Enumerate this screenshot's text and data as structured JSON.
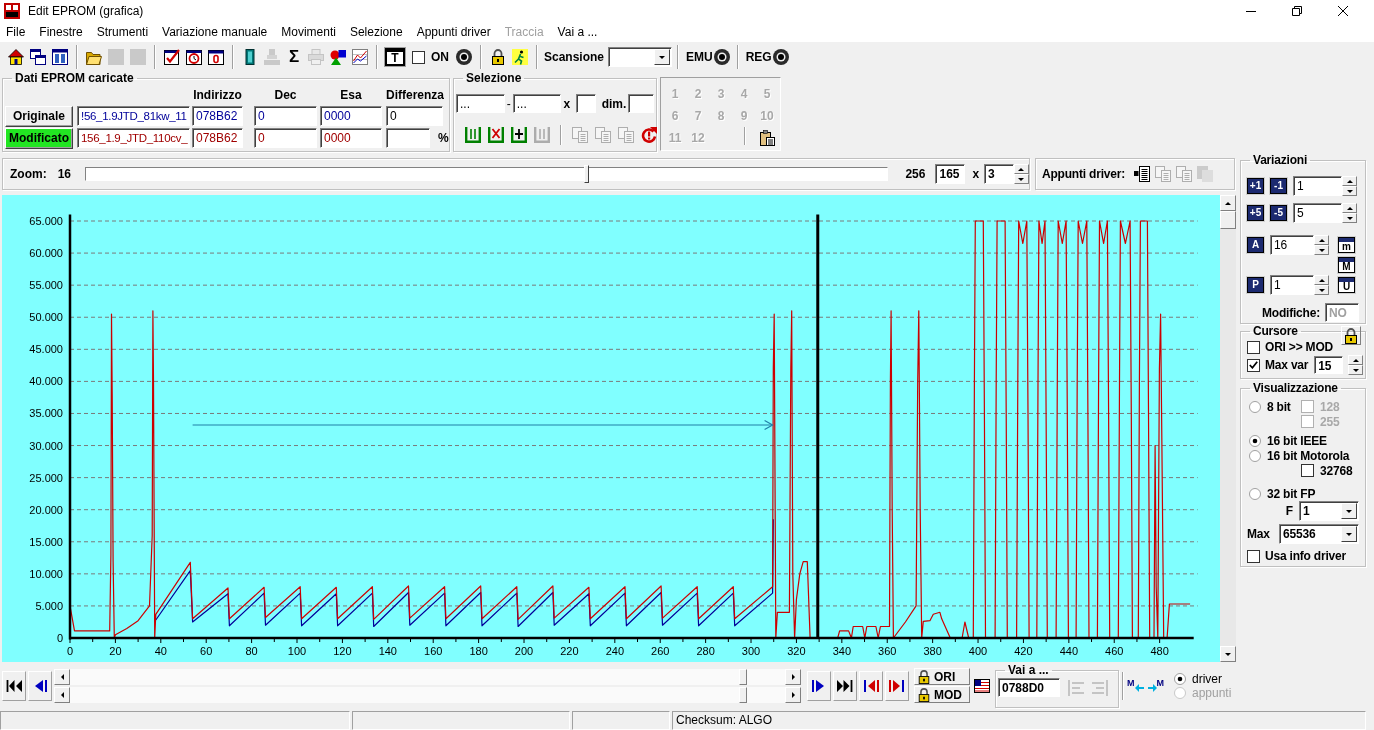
{
  "window": {
    "title": "Edit EPROM (grafica)"
  },
  "menu": [
    {
      "label": "File",
      "disabled": false
    },
    {
      "label": "Finestre",
      "disabled": false
    },
    {
      "label": "Strumenti",
      "disabled": false
    },
    {
      "label": "Variazione manuale",
      "disabled": false
    },
    {
      "label": "Movimenti",
      "disabled": false
    },
    {
      "label": "Selezione",
      "disabled": false
    },
    {
      "label": "Appunti driver",
      "disabled": false
    },
    {
      "label": "Traccia",
      "disabled": true
    },
    {
      "label": "Vai a ...",
      "disabled": false
    }
  ],
  "toolbar": [
    {
      "kind": "button",
      "disabled": false
    },
    {
      "kind": "button",
      "disabled": false
    },
    {
      "kind": "button",
      "disabled": false
    },
    {
      "kind": "separator"
    },
    {
      "kind": "button",
      "disabled": false
    },
    {
      "kind": "button",
      "disabled": true
    },
    {
      "kind": "button",
      "disabled": true
    },
    {
      "kind": "separator"
    },
    {
      "kind": "button",
      "disabled": false
    },
    {
      "kind": "button",
      "disabled": false
    },
    {
      "kind": "button",
      "disabled": false
    },
    {
      "kind": "separator"
    },
    {
      "kind": "button",
      "disabled": false
    },
    {
      "kind": "button",
      "disabled": true
    },
    {
      "kind": "glyph",
      "label": "Σ",
      "disabled": false
    },
    {
      "kind": "button",
      "disabled": true
    },
    {
      "kind": "button",
      "disabled": false
    },
    {
      "kind": "button",
      "disabled": false
    },
    {
      "kind": "separator"
    },
    {
      "kind": "tile",
      "label": "T",
      "disabled": false
    },
    {
      "kind": "checkbox",
      "label": "ON",
      "checked": false
    },
    {
      "kind": "button",
      "disabled": false
    },
    {
      "kind": "separator"
    },
    {
      "kind": "button",
      "disabled": false
    },
    {
      "kind": "button",
      "disabled": false
    },
    {
      "kind": "separator"
    },
    {
      "kind": "combo",
      "label": "Scansione"
    },
    {
      "kind": "separator"
    },
    {
      "kind": "labeled",
      "label": "EMU"
    },
    {
      "kind": "separator"
    },
    {
      "kind": "labeled",
      "label": "REG"
    }
  ],
  "eprom_data": {
    "title": "Dati EPROM caricate",
    "columns": [
      "Indirizzo",
      "Dec",
      "Esa",
      "Differenza"
    ],
    "rows": [
      {
        "label": "Originale",
        "selected": false,
        "color": "#000099",
        "file": "!56_1.9JTD_81kw_11",
        "address": "078B62",
        "dec": "0",
        "hex": "0000",
        "difference": "0"
      },
      {
        "label": "Modificato",
        "selected": true,
        "color": "#a00000",
        "file": "156_1.9_JTD_110cv_",
        "address": "078B62",
        "dec": "0",
        "hex": "0000",
        "unit": "%"
      }
    ]
  },
  "selection": {
    "title": "Selezione",
    "from": "...",
    "separator": "-",
    "to": "...",
    "times": "x",
    "dim_label": "dim.",
    "tools": [
      {
        "disabled": false
      },
      {
        "disabled": false
      },
      {
        "disabled": false
      },
      {
        "disabled": true
      },
      {
        "disabled": true
      },
      {
        "disabled": true
      },
      {
        "disabled": true
      },
      {
        "disabled": false
      }
    ]
  },
  "number_pad": {
    "keys": [
      {
        "label": "1",
        "disabled": true
      },
      {
        "label": "2",
        "disabled": true
      },
      {
        "label": "3",
        "disabled": true
      },
      {
        "label": "4",
        "disabled": true
      },
      {
        "label": "5",
        "disabled": true
      },
      {
        "label": "6",
        "disabled": true
      },
      {
        "label": "7",
        "disabled": true
      },
      {
        "label": "8",
        "disabled": true
      },
      {
        "label": "9",
        "disabled": true
      },
      {
        "label": "10",
        "disabled": true
      },
      {
        "label": "11",
        "disabled": true
      },
      {
        "label": "12",
        "disabled": true
      }
    ],
    "clipboard": {
      "disabled": false
    }
  },
  "zoom": {
    "label": "Zoom:",
    "min": "16",
    "level": 0.624,
    "max": "256",
    "value": "165",
    "times": "x",
    "factor": "3"
  },
  "driver_notes": {
    "label": "Appunti driver:",
    "tools": [
      {
        "disabled": false
      },
      {
        "disabled": true
      },
      {
        "disabled": true
      },
      {
        "disabled": true
      }
    ]
  },
  "chart": {
    "end_arrow": true,
    "chart_data": {
      "type": "line",
      "grid": true,
      "xlim": [
        0,
        495
      ],
      "ylim": [
        0,
        66
      ],
      "xticks": [
        0,
        20,
        40,
        60,
        80,
        100,
        120,
        140,
        160,
        180,
        200,
        220,
        240,
        260,
        280,
        300,
        320,
        340,
        360,
        380,
        400,
        420,
        440,
        460,
        480
      ],
      "yticks": [
        {
          "value": 0,
          "label": "0"
        },
        {
          "value": 5,
          "label": "5.000"
        },
        {
          "value": 10,
          "label": "10.000"
        },
        {
          "value": 15,
          "label": "15.000"
        },
        {
          "value": 20,
          "label": "20.000"
        },
        {
          "value": 25,
          "label": "25.000"
        },
        {
          "value": 30,
          "label": "30.000"
        },
        {
          "value": 35,
          "label": "35.000"
        },
        {
          "value": 40,
          "label": "40.000"
        },
        {
          "value": 45,
          "label": "45.000"
        },
        {
          "value": 50,
          "label": "50.000"
        },
        {
          "value": 55,
          "label": "55.000"
        },
        {
          "value": 60,
          "label": "60.000"
        },
        {
          "value": 65,
          "label": "65.000"
        }
      ],
      "x": [
        0,
        2,
        17.5,
        18,
        18.3,
        18.6,
        19,
        19.5,
        20,
        25,
        30,
        35,
        36.2,
        36.5,
        36.8,
        37.3,
        37.8,
        53,
        54,
        69.6,
        70.2,
        85.5,
        86.1,
        101.4,
        102,
        117.3,
        117.9,
        133.2,
        133.8,
        149.1,
        149.7,
        165,
        165.6,
        180.9,
        181.5,
        196.8,
        197.4,
        212.7,
        213.3,
        228.6,
        229.2,
        244.5,
        245.1,
        260.4,
        261,
        276.3,
        276.9,
        292.2,
        292.8,
        309.5,
        309.8,
        310.2,
        310.9,
        311.6,
        316.9,
        317.5,
        317.9,
        318.4,
        319.2,
        320,
        321.5,
        323,
        324.8,
        326,
        338.2,
        339,
        343,
        344.2,
        345,
        349.2,
        350.1,
        351,
        355,
        356,
        357,
        361,
        361.4,
        361.7,
        362.2,
        362.7,
        368,
        372.7,
        373.4,
        373.9,
        374.5,
        375.2,
        375.9,
        378.8,
        380.3,
        383.2,
        384,
        387.8,
        393,
        394.2,
        395.9,
        397.9,
        398.4,
        398.8,
        402.3,
        402.8,
        403.3,
        407.5,
        408,
        408.4,
        411.9,
        412.4,
        412.9,
        417,
        417.5,
        417.9,
        419.7,
        421.5,
        422,
        422.5,
        425.9,
        426.4,
        426.8,
        428.2,
        429.5,
        430,
        430.5,
        434.4,
        434.9,
        435.3,
        437.1,
        438.8,
        439.3,
        439.8,
        443.2,
        443.7,
        444.1,
        446,
        447.9,
        448.4,
        448.9,
        452.6,
        453.1,
        453.5,
        455.3,
        457,
        457.5,
        458,
        461.8,
        462.3,
        462.7,
        464.9,
        467,
        467.5,
        468,
        470.6,
        471.1,
        471.5,
        474.6,
        475.1,
        475.6,
        477.5,
        478,
        478.5,
        479.2,
        479.9,
        480.4,
        481,
        481.8,
        483.3,
        484.3,
        493.4
      ],
      "series": [
        {
          "color": "#000099",
          "values": [
            null,
            null,
            null,
            null,
            null,
            null,
            null,
            null,
            null,
            null,
            null,
            null,
            null,
            null,
            null,
            null,
            2.8,
            10.5,
            2.5,
            6.9,
            1.9,
            7,
            2,
            7,
            1.9,
            6.9,
            1.9,
            7,
            1.8,
            7.1,
            2,
            7,
            1.9,
            7.1,
            1.9,
            7,
            1.8,
            7.1,
            2,
            6.9,
            1.9,
            7,
            1.9,
            7.1,
            2,
            7,
            1.9,
            7,
            1.9,
            7,
            18.5,
            null,
            null,
            null,
            null,
            null,
            null,
            null,
            null,
            null,
            null,
            null,
            null,
            null,
            null,
            null,
            null,
            null,
            null,
            null,
            null,
            null,
            null,
            null,
            null,
            null,
            null,
            null,
            null,
            null,
            null,
            null,
            null,
            null,
            null,
            null,
            null,
            null,
            null,
            null,
            null,
            null,
            null,
            null,
            null,
            null,
            null,
            null,
            null,
            null,
            null,
            null,
            null,
            null,
            null,
            null,
            null,
            null,
            null,
            null,
            null,
            null,
            null,
            null,
            null,
            null,
            null,
            null,
            null,
            null,
            null,
            null,
            null,
            null,
            null,
            null,
            null,
            null,
            null,
            null,
            null,
            null,
            null,
            null,
            null,
            null,
            null,
            null,
            null,
            null,
            null,
            null,
            null,
            null,
            null,
            null,
            null,
            null,
            null,
            null,
            null,
            null,
            null,
            null,
            null,
            null,
            null,
            null,
            null,
            null,
            null,
            null,
            null,
            null,
            null,
            null
          ]
        },
        {
          "color": "#cc0000",
          "values": [
            5,
            1.1,
            1.1,
            13,
            50.5,
            38,
            12,
            0,
            0.5,
            1.5,
            2.7,
            5,
            16,
            51,
            40,
            0,
            3.7,
            11.8,
            3,
            7.8,
            3,
            7.9,
            3.2,
            8,
            3,
            7.9,
            3,
            8,
            2.9,
            8.1,
            3.1,
            8,
            3,
            8.1,
            3,
            8,
            2.9,
            8.1,
            3.1,
            7.9,
            3,
            8,
            3,
            8.1,
            3.1,
            8,
            3,
            8,
            3,
            8,
            42,
            50.5,
            0,
            4,
            4,
            42,
            51,
            10,
            0,
            6,
            10,
            11.9,
            11.9,
            0,
            0,
            1.1,
            1.1,
            0,
            1.8,
            1.8,
            0,
            1.8,
            1.8,
            0,
            1.8,
            1.8,
            40,
            51,
            20,
            0,
            2.5,
            5,
            40,
            51,
            20,
            0,
            2.6,
            2.7,
            3.7,
            4,
            3,
            0,
            0,
            2.5,
            0,
            0,
            40,
            65,
            65,
            35,
            0,
            0,
            40,
            65,
            65,
            35,
            0,
            0,
            40,
            65,
            61.5,
            65,
            35,
            0,
            0,
            40,
            65,
            61.5,
            65,
            35,
            0,
            0,
            40,
            65,
            61.5,
            65,
            35,
            0,
            0,
            40,
            65,
            61.5,
            65,
            35,
            0,
            0,
            40,
            65,
            61.5,
            65,
            35,
            0,
            0,
            40,
            65,
            61.5,
            65,
            35,
            0,
            0,
            40,
            65,
            65,
            35,
            0,
            0,
            30,
            8,
            0,
            42,
            50.5,
            30,
            0,
            0,
            5.3,
            5.3
          ]
        },
        {
          "color": "#2080a8",
          "values": [
            null,
            null,
            null,
            null,
            null,
            null,
            null,
            null,
            null,
            null,
            null,
            null,
            null,
            null,
            null,
            null,
            null,
            null,
            33.2,
            33.2,
            33.2,
            33.2,
            33.2,
            33.2,
            33.2,
            33.2,
            33.2,
            33.2,
            33.2,
            33.2,
            33.2,
            33.2,
            33.2,
            33.2,
            33.2,
            33.2,
            33.2,
            33.2,
            33.2,
            33.2,
            33.2,
            33.2,
            33.2,
            33.2,
            33.2,
            33.2,
            33.2,
            33.2,
            33.2,
            33.2,
            null,
            null,
            null,
            null,
            null,
            null,
            null,
            null,
            null,
            null,
            null,
            null,
            null,
            null,
            null,
            null,
            null,
            null,
            null,
            null,
            null,
            null,
            null,
            null,
            null,
            null,
            null,
            null,
            null,
            null,
            null,
            null,
            null,
            null,
            null,
            null,
            null,
            null,
            null,
            null,
            null,
            null,
            null,
            null,
            null,
            null,
            null,
            null,
            null,
            null,
            null,
            null,
            null,
            null,
            null,
            null,
            null,
            null,
            null,
            null,
            null,
            null,
            null,
            null,
            null,
            null,
            null,
            null,
            null,
            null,
            null,
            null,
            null,
            null,
            null,
            null,
            null,
            null,
            null,
            null,
            null,
            null,
            null,
            null,
            null,
            null,
            null,
            null,
            null,
            null,
            null,
            null,
            null,
            null,
            null,
            null,
            null,
            null,
            null,
            null,
            null,
            null,
            null,
            null,
            null,
            null,
            null,
            null,
            null,
            null,
            null,
            null,
            null,
            null,
            null,
            null
          ]
        }
      ],
      "ref_lines": [
        {
          "axis": "x",
          "value": 329.4
        }
      ]
    }
  },
  "variations": {
    "title": "Variazioni",
    "steps": [
      {
        "plus": "+1",
        "minus": "-1",
        "value": "1"
      },
      {
        "plus": "+5",
        "minus": "-5",
        "value": "5"
      }
    ],
    "settings": [
      {
        "button": "A",
        "value": "16",
        "side": "m"
      },
      {
        "side": "M"
      },
      {
        "button": "P",
        "value": "1",
        "side": "U"
      }
    ],
    "changes": {
      "label": "Modifiche:",
      "value": "NO",
      "disabled": true
    }
  },
  "cursor": {
    "title": "Cursore",
    "options": [
      {
        "label": "ORI >> MOD",
        "checked": false
      },
      {
        "label": "Max var",
        "checked": true,
        "value": "15"
      }
    ]
  },
  "display": {
    "title": "Visualizzazione",
    "options": [
      {
        "label": "8 bit",
        "selected": false,
        "checks": [
          {
            "label": "128",
            "checked": false,
            "disabled": true
          },
          {
            "label": "255",
            "checked": false,
            "disabled": true
          }
        ]
      },
      {
        "label": "16 bit IEEE",
        "selected": true
      },
      {
        "label": "16 bit Motorola",
        "selected": false,
        "checks": [
          {
            "label": "32768",
            "checked": false,
            "disabled": false
          }
        ]
      },
      {
        "label": "32 bit FP",
        "selected": false
      }
    ],
    "factor": {
      "label": "F",
      "value": "1"
    },
    "max": {
      "label": "Max",
      "value": "65536"
    },
    "driver_info": {
      "label": "Usa info driver",
      "checked": false
    }
  },
  "navigation": {
    "ori": "ORI",
    "mod": "MOD",
    "goto": {
      "title": "Vai a ...",
      "value": "0788D0",
      "tools": [
        {
          "disabled": true
        },
        {
          "disabled": true
        }
      ]
    },
    "swap": {
      "left": "M",
      "right": "M"
    },
    "targets": [
      {
        "label": "driver",
        "selected": true,
        "disabled": false
      },
      {
        "label": "appunti",
        "selected": false,
        "disabled": true
      }
    ]
  },
  "status_bar": {
    "checksum": "Checksum: ALGO"
  }
}
